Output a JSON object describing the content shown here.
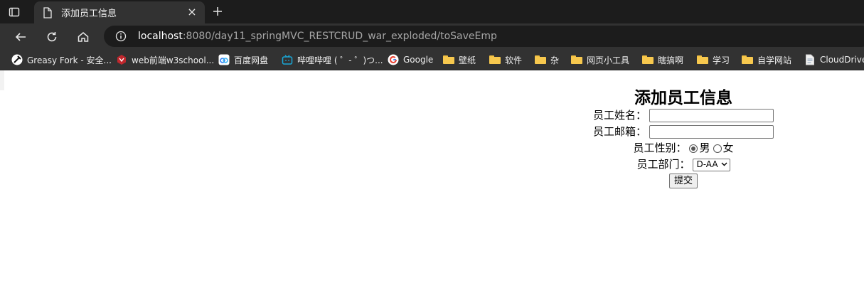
{
  "browser": {
    "tab": {
      "title": "添加员工信息",
      "icon": "document-icon",
      "close": "×"
    },
    "new_tab": "+",
    "address": {
      "host": "localhost",
      "rest": ":8080/day11_springMVC_RESTCRUD_war_exploded/toSaveEmp"
    },
    "bookmarks": [
      {
        "label": "Greasy Fork - 安全...",
        "icon": "greasyfork-icon"
      },
      {
        "label": "web前端w3school...",
        "icon": "w3school-icon"
      },
      {
        "label": "百度网盘",
        "icon": "baidu-pan-icon"
      },
      {
        "label": "哔哩哔哩 ( ゜- ゜)つ...",
        "icon": "bilibili-icon"
      },
      {
        "label": "Google",
        "icon": "google-icon"
      },
      {
        "label": "壁纸",
        "icon": "folder-icon"
      },
      {
        "label": "软件",
        "icon": "folder-icon"
      },
      {
        "label": "杂",
        "icon": "folder-icon"
      },
      {
        "label": "网页小工具",
        "icon": "folder-icon"
      },
      {
        "label": "瞎搞啊",
        "icon": "folder-icon"
      },
      {
        "label": "学习",
        "icon": "folder-icon"
      },
      {
        "label": "自学网站",
        "icon": "folder-icon"
      },
      {
        "label": "CloudDrive",
        "icon": "page-icon"
      }
    ]
  },
  "form": {
    "title": "添加员工信息",
    "name_label": "员工姓名：",
    "name_value": "",
    "email_label": "员工邮箱：",
    "email_value": "",
    "gender_label": "员工性别：",
    "gender_options": [
      "男",
      "女"
    ],
    "gender_selected": "男",
    "dept_label": "员工部门：",
    "dept_selected": "D-AA",
    "submit_label": "提交"
  }
}
